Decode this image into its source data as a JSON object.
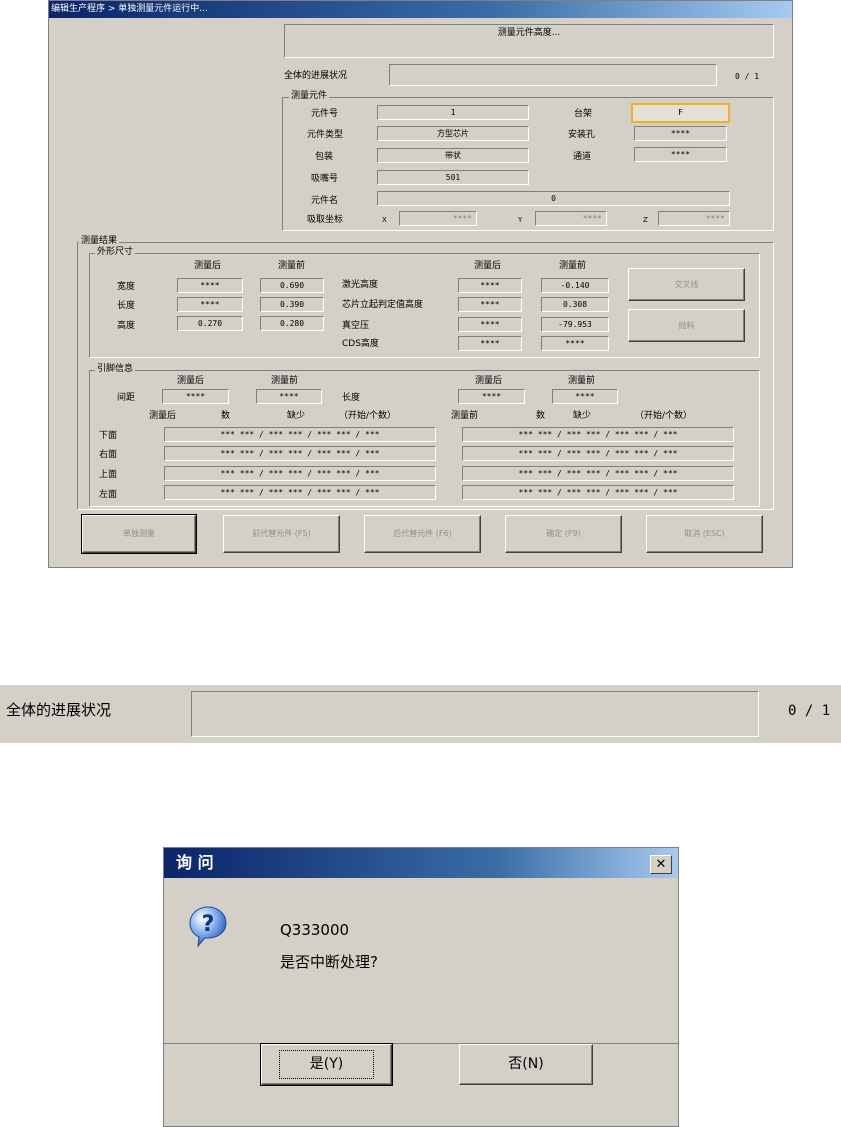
{
  "window": {
    "title": "编辑生产程序 > 单独测量元件运行中...",
    "message": "测量元件高度...",
    "progress_label": "全体的进展状况",
    "progress_count": "0 / 1"
  },
  "measure_part": {
    "group_title": "测量元件",
    "part_no_label": "元件号",
    "part_no": "1",
    "part_type_label": "元件类型",
    "part_type": "方型芯片",
    "package_label": "包装",
    "package": "带状",
    "nozzle_label": "吸嘴号",
    "nozzle": "501",
    "part_name_label": "元件名",
    "part_name": "0",
    "pick_coord_label": "吸取坐标",
    "x_label": "X",
    "x_value": "****",
    "y_label": "Y",
    "y_value": "****",
    "z_label": "Z",
    "z_value": "****",
    "rack_label": "台架",
    "rack": "F",
    "mount_hole_label": "安装孔",
    "mount_hole": "****",
    "lane_label": "通道",
    "lane": "****"
  },
  "results": {
    "group_title": "测量结果",
    "outline_title": "外形尺寸",
    "after_label": "测量后",
    "before_label": "测量前",
    "rows": [
      {
        "label": "宽度",
        "after": "****",
        "before": "0.690"
      },
      {
        "label": "长度",
        "after": "****",
        "before": "0.390"
      },
      {
        "label": "高度",
        "after": "0.270",
        "before": "0.280"
      }
    ],
    "rows2": [
      {
        "label": "激光高度",
        "after": "****",
        "before": "-0.140"
      },
      {
        "label": "芯片立起判定值高度",
        "after": "****",
        "before": "0.308"
      },
      {
        "label": "真空压",
        "after": "****",
        "before": "-79.953"
      },
      {
        "label": "CDS高度",
        "after": "****",
        "before": "****"
      }
    ],
    "btn_crossline": "交叉线",
    "btn_discard": "抛料"
  },
  "leads": {
    "group_title": "引脚信息",
    "after_label": "测量后",
    "before_label": "测量前",
    "pitch_label": "间距",
    "pitch_after": "****",
    "pitch_before": "****",
    "length_label": "长度",
    "length_after": "****",
    "length_before": "****",
    "col_after": "测量后",
    "col_count": "数",
    "col_missing": "缺少",
    "col_startcount": "（开始/个数）",
    "col_before": "测量前",
    "col_count2": "数",
    "col_missing2": "缺少",
    "col_startcount2": "（开始/个数）",
    "sides": [
      {
        "label": "下面",
        "after": "*** *** / *** *** / *** *** / ***",
        "before": "*** *** / *** *** / *** *** / ***"
      },
      {
        "label": "右面",
        "after": "*** *** / *** *** / *** *** / ***",
        "before": "*** *** / *** *** / *** *** / ***"
      },
      {
        "label": "上面",
        "after": "*** *** / *** *** / *** *** / ***",
        "before": "*** *** / *** *** / *** *** / ***"
      },
      {
        "label": "左面",
        "after": "*** *** / *** *** / *** *** / ***",
        "before": "*** *** / *** *** / *** *** / ***"
      }
    ]
  },
  "footer_buttons": [
    "单独测量",
    "前代替元件 (F5)",
    "后代替元件 (F6)",
    "确定 (F9)",
    "取消 (ESC)"
  ],
  "strip": {
    "label": "全体的进展状况",
    "count": "0 / 1"
  },
  "dialog": {
    "title": "询 问",
    "code": "Q333000",
    "question": "是否中断处理?",
    "yes": "是(Y)",
    "no": "否(N)",
    "close": "✕"
  },
  "colors": {
    "highlight_border": "#f0b020",
    "face": "#d4d0c8",
    "title_dark": "#0a246a"
  }
}
